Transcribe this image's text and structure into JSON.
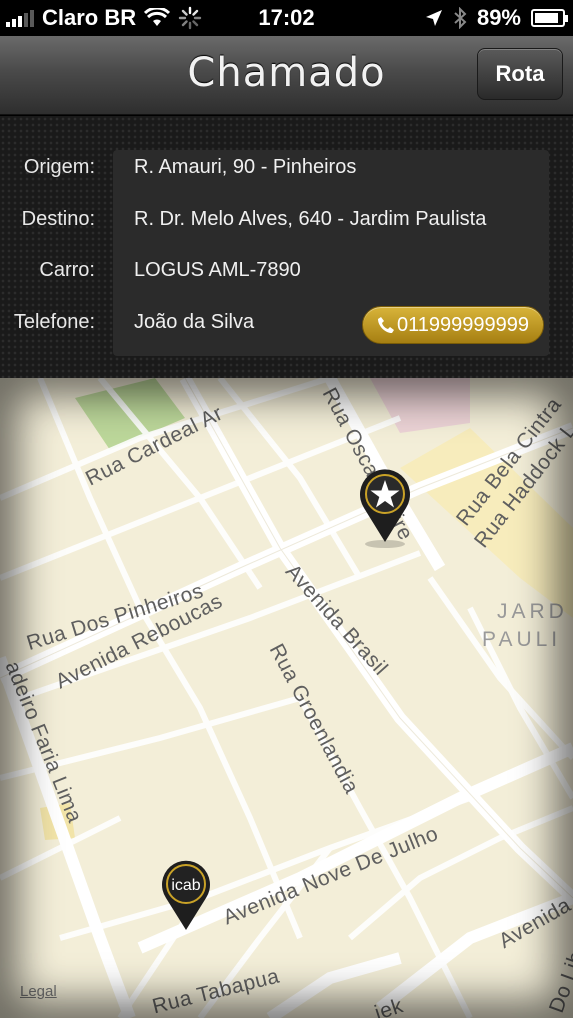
{
  "status_bar": {
    "carrier": "Claro BR",
    "time": "17:02",
    "battery": "89%",
    "battery_level": 0.89
  },
  "navbar": {
    "title": "Chamado",
    "route_button": "Rota"
  },
  "details": {
    "origin_label": "Origem:",
    "origin_value": "R. Amauri, 90 - Pinheiros",
    "destination_label": "Destino:",
    "destination_value": "R. Dr. Melo Alves, 640 - Jardim Paulista",
    "car_label": "Carro:",
    "car_value": "LOGUS AML-7890",
    "phone_label": "Telefone:",
    "phone_name": "João da Silva",
    "phone_number": "011999999999"
  },
  "map": {
    "streets": {
      "cardeal": "Rua Cardeal Ar",
      "oscar": "Rua Oscar Freire",
      "bela_cintra": "Rua Bela Cintra",
      "haddock": "Rua Haddock L",
      "pinheiros": "Rua Dos Pinheiros",
      "reboucas": "Avenida Reboucas",
      "brasil": "Avenida Brasil",
      "jardim_1": "JARD",
      "jardim_2": "PAULI",
      "faria_lima": "adeiro Faria Lima",
      "groenlandia": "Rua Groenlandia",
      "nove_julho": "Avenida Nove De Julho",
      "avenida_right": "Avenida",
      "libano": "Do Libano",
      "tabapua": "Rua Tabapua",
      "iek": "iek"
    },
    "pin_logo": "icab",
    "legal": "Legal"
  },
  "colors": {
    "gold": "#c9a227",
    "map_bg": "#f3eed8"
  }
}
